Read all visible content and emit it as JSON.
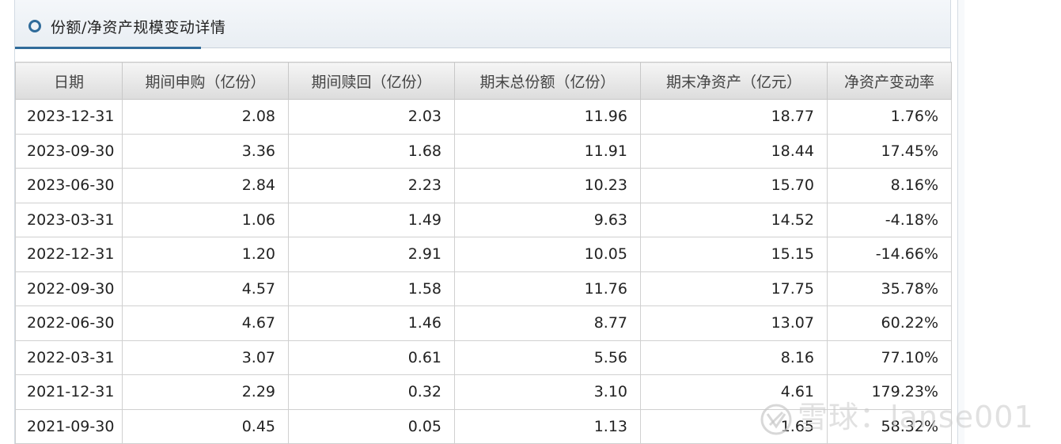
{
  "panel": {
    "title": "份额/净资产规模变动详情"
  },
  "table": {
    "headers": [
      "日期",
      "期间申购（亿份）",
      "期间赎回（亿份）",
      "期末总份额（亿份）",
      "期末净资产（亿元）",
      "净资产变动率"
    ],
    "rows": [
      [
        "2023-12-31",
        "2.08",
        "2.03",
        "11.96",
        "18.77",
        "1.76%"
      ],
      [
        "2023-09-30",
        "3.36",
        "1.68",
        "11.91",
        "18.44",
        "17.45%"
      ],
      [
        "2023-06-30",
        "2.84",
        "2.23",
        "10.23",
        "15.70",
        "8.16%"
      ],
      [
        "2023-03-31",
        "1.06",
        "1.49",
        "9.63",
        "14.52",
        "-4.18%"
      ],
      [
        "2022-12-31",
        "1.20",
        "2.91",
        "10.05",
        "15.15",
        "-14.66%"
      ],
      [
        "2022-09-30",
        "4.57",
        "1.58",
        "11.76",
        "17.75",
        "35.78%"
      ],
      [
        "2022-06-30",
        "4.67",
        "1.46",
        "8.77",
        "13.07",
        "60.22%"
      ],
      [
        "2022-03-31",
        "3.07",
        "0.61",
        "5.56",
        "8.16",
        "77.10%"
      ],
      [
        "2021-12-31",
        "2.29",
        "0.32",
        "3.10",
        "4.61",
        "179.23%"
      ],
      [
        "2021-09-30",
        "0.45",
        "0.05",
        "1.13",
        "1.65",
        "58.32%"
      ]
    ]
  },
  "watermark": {
    "text": "雪球：lanse001",
    "logo_icon": "xueqiu-logo-icon"
  },
  "colors": {
    "accent": "#2f6b9a",
    "header_bg": "#e9eef3",
    "table_header_bg": "#dcdcdc"
  }
}
